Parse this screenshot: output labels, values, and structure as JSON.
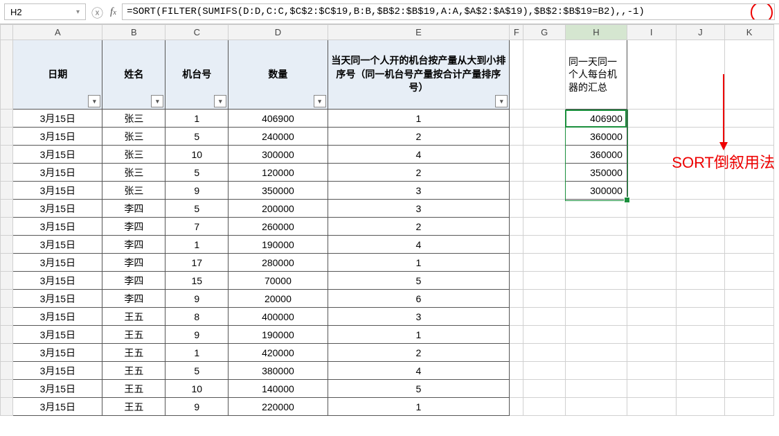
{
  "namebox": {
    "value": "H2"
  },
  "formula": {
    "text": "=SORT(FILTER(SUMIFS(D:D,C:C,$C$2:$C$19,B:B,$B$2:$B$19,A:A,$A$2:$A$19),$B$2:$B$19=B2),,-1)"
  },
  "columns": [
    "A",
    "B",
    "C",
    "D",
    "E",
    "F",
    "G",
    "H",
    "I",
    "J",
    "K"
  ],
  "header_row": {
    "A": "日期",
    "B": "姓名",
    "C": "机台号",
    "D": "数量",
    "E": "当天同一个人开的机台按产量从大到小排序号（同一机台号产量按合计产量排序号）",
    "H": "同一天同一个人每台机器的汇总"
  },
  "rows": [
    {
      "A": "3月15日",
      "B": "张三",
      "C": "1",
      "D": "406900",
      "E": "1",
      "H": "406900"
    },
    {
      "A": "3月15日",
      "B": "张三",
      "C": "5",
      "D": "240000",
      "E": "2",
      "H": "360000"
    },
    {
      "A": "3月15日",
      "B": "张三",
      "C": "10",
      "D": "300000",
      "E": "4",
      "H": "360000"
    },
    {
      "A": "3月15日",
      "B": "张三",
      "C": "5",
      "D": "120000",
      "E": "2",
      "H": "350000"
    },
    {
      "A": "3月15日",
      "B": "张三",
      "C": "9",
      "D": "350000",
      "E": "3",
      "H": "300000"
    },
    {
      "A": "3月15日",
      "B": "李四",
      "C": "5",
      "D": "200000",
      "E": "3",
      "H": ""
    },
    {
      "A": "3月15日",
      "B": "李四",
      "C": "7",
      "D": "260000",
      "E": "2",
      "H": ""
    },
    {
      "A": "3月15日",
      "B": "李四",
      "C": "1",
      "D": "190000",
      "E": "4",
      "H": ""
    },
    {
      "A": "3月15日",
      "B": "李四",
      "C": "17",
      "D": "280000",
      "E": "1",
      "H": ""
    },
    {
      "A": "3月15日",
      "B": "李四",
      "C": "15",
      "D": "70000",
      "E": "5",
      "H": ""
    },
    {
      "A": "3月15日",
      "B": "李四",
      "C": "9",
      "D": "20000",
      "E": "6",
      "H": ""
    },
    {
      "A": "3月15日",
      "B": "王五",
      "C": "8",
      "D": "400000",
      "E": "3",
      "H": ""
    },
    {
      "A": "3月15日",
      "B": "王五",
      "C": "9",
      "D": "190000",
      "E": "1",
      "H": ""
    },
    {
      "A": "3月15日",
      "B": "王五",
      "C": "1",
      "D": "420000",
      "E": "2",
      "H": ""
    },
    {
      "A": "3月15日",
      "B": "王五",
      "C": "5",
      "D": "380000",
      "E": "4",
      "H": ""
    },
    {
      "A": "3月15日",
      "B": "王五",
      "C": "10",
      "D": "140000",
      "E": "5",
      "H": ""
    },
    {
      "A": "3月15日",
      "B": "王五",
      "C": "9",
      "D": "220000",
      "E": "1",
      "H": ""
    }
  ],
  "annotation": {
    "text": "SORT倒叙用法"
  },
  "filter_glyph": "▾"
}
